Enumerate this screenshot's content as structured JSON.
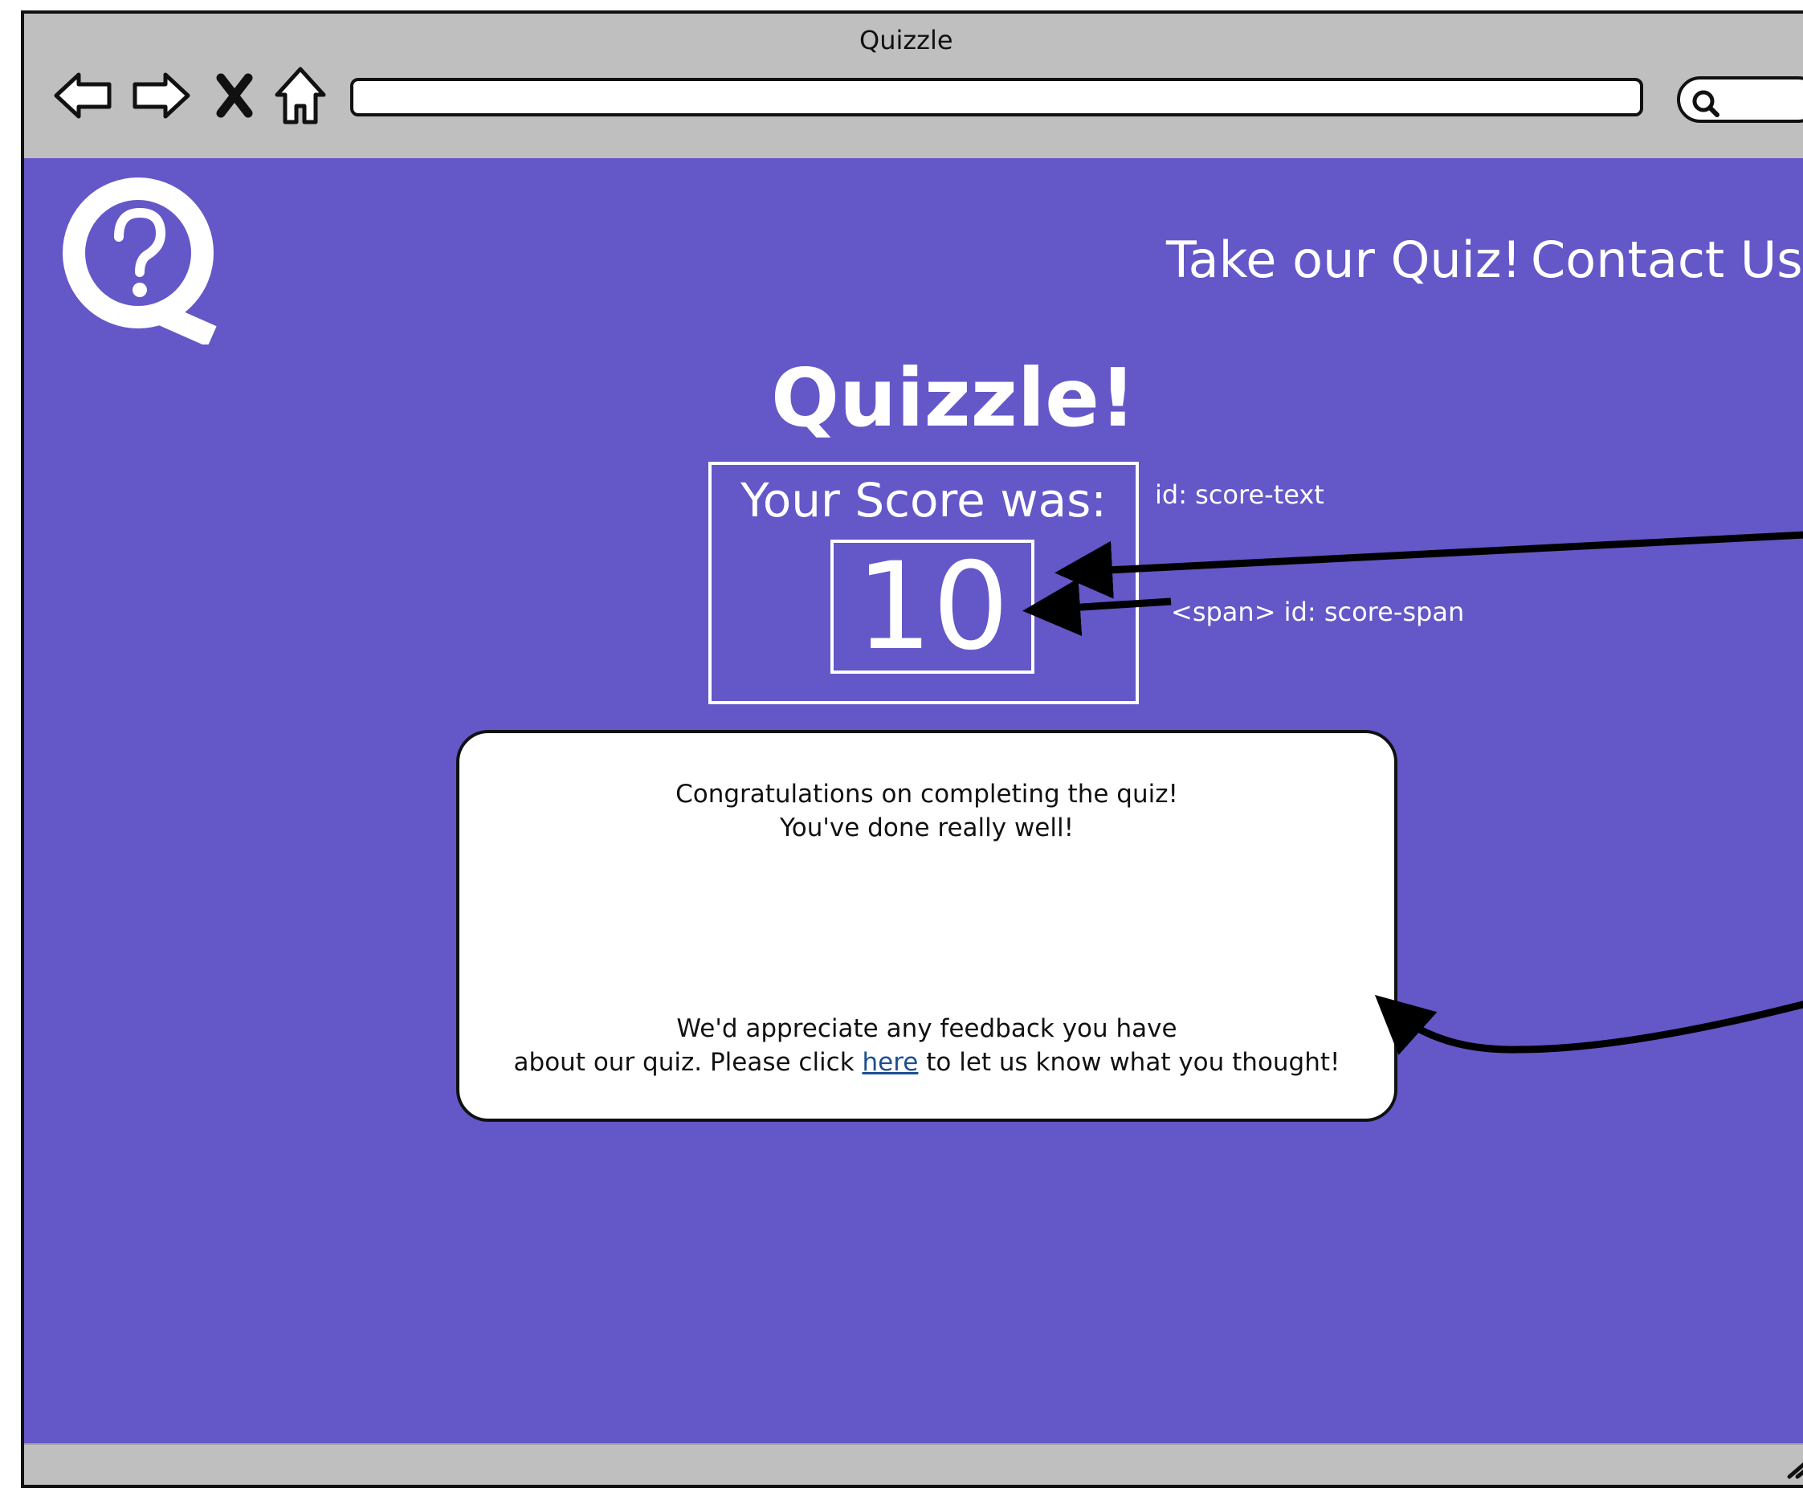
{
  "window": {
    "title": "Quizzle"
  },
  "nav": {
    "back_icon": "back-arrow-icon",
    "forward_icon": "forward-arrow-icon",
    "close_icon": "close-icon",
    "home_icon": "home-icon",
    "search_icon": "search-icon"
  },
  "header": {
    "links": [
      "Take our Quiz!",
      "Contact Us"
    ]
  },
  "main": {
    "heading": "Quizzle!",
    "score_label": "Your Score was:",
    "score_value": "10"
  },
  "annotations": {
    "score_text": "id: score-text",
    "score_span": "<span> id: score-span"
  },
  "message": {
    "line1": "Congratulations on completing the quiz!",
    "line2": "You've done really well!",
    "line3": "We'd appreciate any feedback you have",
    "line4_prefix": "about our quiz. Please click ",
    "line4_link": "here",
    "line4_suffix": " to let us know what you thought!"
  },
  "colors": {
    "background": "#6457c8",
    "chrome": "#bfbfbf",
    "link": "#1d4f91"
  }
}
